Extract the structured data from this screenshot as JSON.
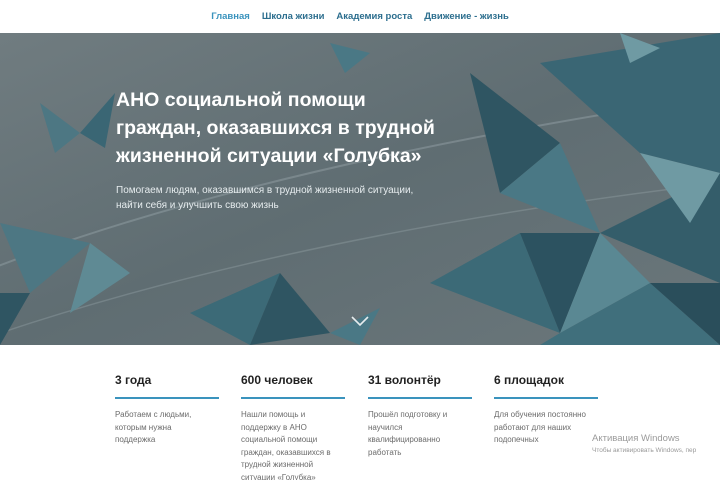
{
  "nav": {
    "items": [
      {
        "label": "Главная",
        "active": true
      },
      {
        "label": "Школа жизни",
        "active": false
      },
      {
        "label": "Академия роста",
        "active": false
      },
      {
        "label": "Движение - жизнь",
        "active": false
      }
    ]
  },
  "hero": {
    "title_lines": [
      "АНО социальной помощи",
      "граждан, оказавшихся в трудной",
      "жизненной ситуации «Голубка»"
    ],
    "subtitle_lines": [
      "Помогаем людям, оказавшимся в трудной жизненной ситуации,",
      "найти себя и улучшить свою жизнь"
    ],
    "scroll_icon": "chevron-down-icon"
  },
  "stats": [
    {
      "value": "3 года",
      "lines": [
        "Работаем с людьми,",
        "которым нужна",
        "поддержка"
      ]
    },
    {
      "value": "600 человек",
      "lines": [
        "Нашли помощь и",
        "поддержку в АНО",
        "социальной помощи",
        "граждан, оказавшихся в",
        "трудной жизненной",
        "ситуации «Голубка»"
      ]
    },
    {
      "value": "31 волонтёр",
      "lines": [
        "Прошёл подготовку и",
        "научился",
        "квалифицированно",
        "работать"
      ]
    },
    {
      "value": "6 площадок",
      "lines": [
        "Для обучения постоянно",
        "работают для наших",
        "подопечных"
      ]
    }
  ],
  "watermark": {
    "title": "Активация Windows",
    "subtitle": "Чтобы активировать Windows, пер"
  },
  "colors": {
    "nav_link": "#2c6e8e",
    "accent": "#3a93bd",
    "hero_bg": "#5b6a70",
    "polygon_dark": "#2f5562",
    "polygon_light": "#6f9aa3"
  }
}
